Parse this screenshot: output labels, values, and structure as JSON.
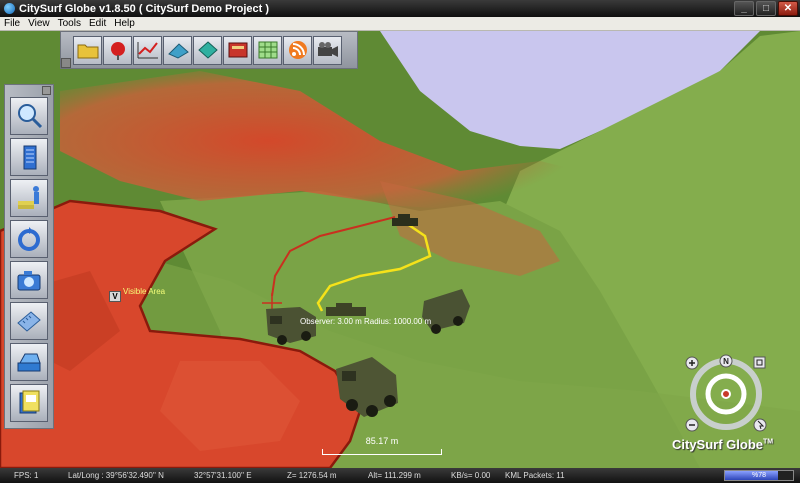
{
  "window": {
    "title": "CitySurf Globe v1.8.50   ( CitySurf Demo Project )",
    "controls": {
      "minimize": "_",
      "maximize": "□",
      "close": "✕"
    }
  },
  "menu": {
    "items": [
      "File",
      "View",
      "Tools",
      "Edit",
      "Help"
    ]
  },
  "top_toolbar": {
    "buttons": [
      {
        "icon": "folder-icon"
      },
      {
        "icon": "red-ball-icon"
      },
      {
        "icon": "line-graph-icon"
      },
      {
        "icon": "plane-layer-icon"
      },
      {
        "icon": "diamond-layer-icon"
      },
      {
        "icon": "book-icon"
      },
      {
        "icon": "grid-table-icon"
      },
      {
        "icon": "rss-feed-icon"
      },
      {
        "icon": "video-camera-icon"
      }
    ]
  },
  "left_toolbar": {
    "buttons": [
      {
        "icon": "magnifier-icon"
      },
      {
        "icon": "building-icon"
      },
      {
        "icon": "person-layers-icon"
      },
      {
        "icon": "ring-rotate-icon"
      },
      {
        "icon": "camera-icon"
      },
      {
        "icon": "ruler-icon"
      },
      {
        "icon": "device-layer-icon"
      },
      {
        "icon": "card-stack-icon"
      }
    ]
  },
  "overlays": {
    "visible_area_label": "Visible Area",
    "visible_marker": "V",
    "observer_label": "Observer: 3.00 m    Radius: 1000.00 m",
    "scale_label": "85.17 m",
    "brand": "CitySurf Globe",
    "trademark": "TM",
    "compass_north": "N"
  },
  "status": {
    "fps": "FPS: 1",
    "latlong": "Lat/Long : 39°56'32.490'' N",
    "longitude": "32°57'31.100'' E",
    "z": "Z= 1276.54 m",
    "alt": "Alt= 111.299 m",
    "kbs": "KB/s= 0.00",
    "kml": "KML Packets: 11",
    "progress_label": "%78",
    "progress_value": 78
  },
  "colors": {
    "sky": "#c9c6ee",
    "terrain": "#6f9b3c",
    "visibility_zone": "#d94a2b",
    "path_yellow": "#f5e21a",
    "path_red": "#c9301f"
  }
}
